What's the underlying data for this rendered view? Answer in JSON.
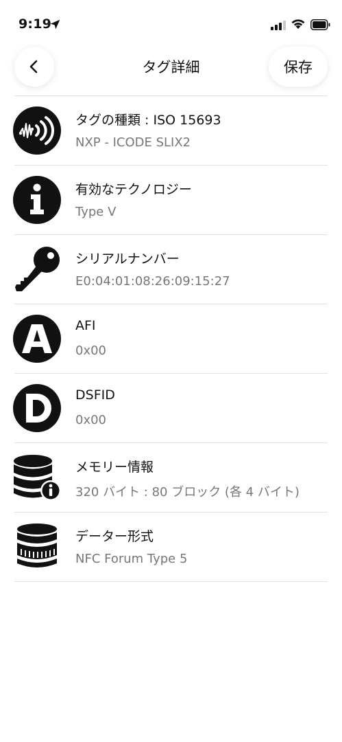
{
  "status": {
    "time": "9:19"
  },
  "nav": {
    "title": "タグ詳細",
    "save_label": "保存",
    "back_icon": "chevron-left-icon"
  },
  "items": [
    {
      "title": "タグの種類 : ISO 15693",
      "value": "NXP - ICODE SLIX2",
      "icon": "nfc-signal-icon"
    },
    {
      "title": "有効なテクノロジー",
      "value": "Type V",
      "icon": "info-icon"
    },
    {
      "title": "シリアルナンバー",
      "value": "E0:04:01:08:26:09:15:27",
      "icon": "key-icon"
    },
    {
      "title": "AFI",
      "value": "0x00",
      "icon": "letter-a-icon"
    },
    {
      "title": "DSFID",
      "value": "0x00",
      "icon": "letter-d-icon"
    },
    {
      "title": "メモリー情報",
      "value": "320 バイト : 80 ブロック (各 4 バイト)",
      "icon": "database-info-icon"
    },
    {
      "title": "データー形式",
      "value": "NFC Forum Type 5",
      "icon": "database-icon"
    }
  ]
}
